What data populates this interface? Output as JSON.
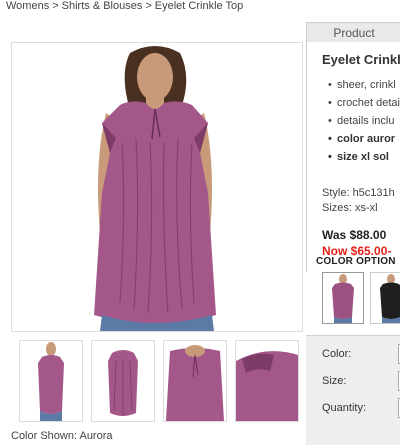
{
  "breadcrumb": {
    "items": [
      "Womens",
      "Shirts & Blouses",
      "Eyelet Crinkle Top"
    ],
    "separator": ">"
  },
  "product": {
    "tab_label": "Product",
    "title": "Eyelet Crinkl",
    "bullets": [
      "sheer, crinkl",
      "crochet detai",
      "details inclu",
      "color auror",
      "size xl sol"
    ],
    "style": "Style: h5c131h",
    "sizes": "Sizes: xs-xl",
    "was_price": "Was $88.00",
    "now_price": "Now $65.00-",
    "color_options_label": "COLOR OPTION",
    "swatches": [
      {
        "name": "Aurora",
        "color": "#9c5180",
        "selected": true
      },
      {
        "name": "Black",
        "color": "#1f1f1f",
        "selected": false
      }
    ]
  },
  "purchase_form": {
    "color_label": "Color:",
    "size_label": "Size:",
    "quantity_label": "Quantity:"
  },
  "gallery": {
    "thumbnail_count": 4,
    "color_shown": "Color Shown: Aurora"
  },
  "colors": {
    "top": "#a4588a",
    "top_shadow": "#7d3b67",
    "skin": "#c99a7a",
    "hair": "#4a3020",
    "jeans": "#5c7aa6",
    "price_now": "#e32119"
  }
}
